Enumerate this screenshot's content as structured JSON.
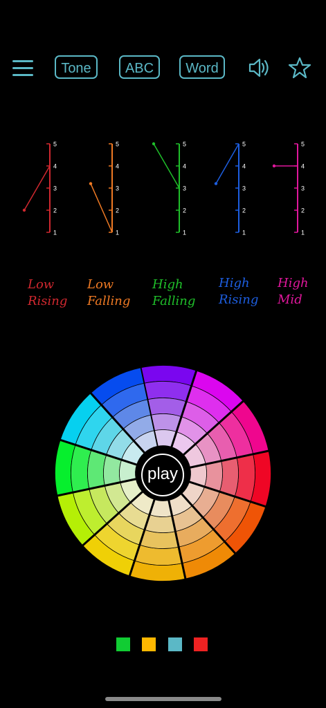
{
  "toolbar": {
    "tone_label": "Tone",
    "abc_label": "ABC",
    "word_label": "Word",
    "accent_color": "#5bb8c6",
    "icons": [
      "menu-icon",
      "speaker-icon",
      "star-icon"
    ]
  },
  "tones": [
    {
      "label_line1": "Low",
      "label_line2": "Rising",
      "color": "#d0282f"
    },
    {
      "label_line1": "Low",
      "label_line2": "Falling",
      "color": "#f07a24"
    },
    {
      "label_line1": "High",
      "label_line2": "Falling",
      "color": "#1fbf2a"
    },
    {
      "label_line1": "High",
      "label_line2": "Rising",
      "color": "#1d5ee0"
    },
    {
      "label_line1": "High",
      "label_line2": "Mid",
      "color": "#e0179c"
    }
  ],
  "scale_labels": [
    "5",
    "4",
    "3",
    "2",
    "1"
  ],
  "play_label": "play",
  "swatches": [
    "#11cc33",
    "#ffb800",
    "#5bb8c6",
    "#ee2222"
  ]
}
